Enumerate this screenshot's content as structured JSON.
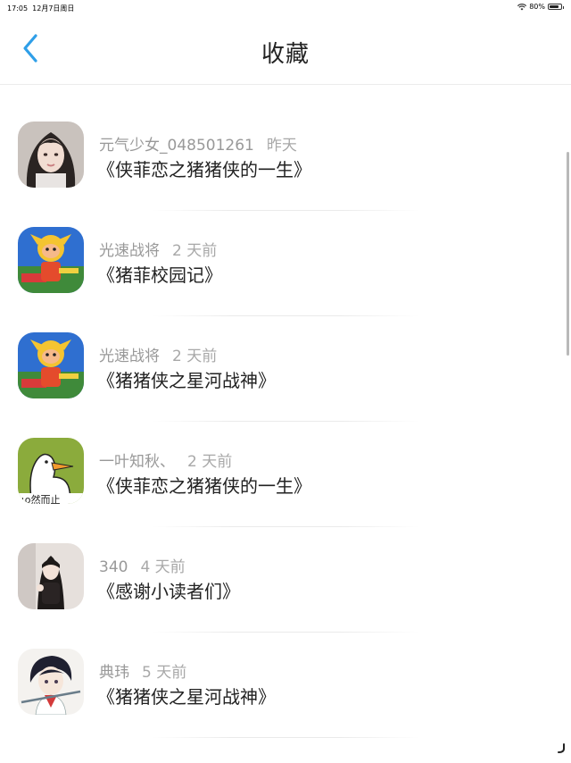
{
  "status_bar": {
    "time": "17:05",
    "date": "12月7日周日",
    "battery": "80%",
    "battery_level": 0.8
  },
  "nav": {
    "title": "收藏",
    "back_icon": "chevron-left-icon",
    "accent_color": "#2f9fe8"
  },
  "favorites": [
    {
      "user": "元气少女_048501261",
      "time": "昨天",
      "title": "《侠菲恋之猪猪侠的一生》",
      "avatar": "girl-portrait"
    },
    {
      "user": "光速战将",
      "time": "2 天前",
      "title": "《猪菲校园记》",
      "avatar": "cartoon-hero"
    },
    {
      "user": "光速战将",
      "time": "2 天前",
      "title": "《猪猪侠之星河战神》",
      "avatar": "cartoon-hero"
    },
    {
      "user": "一叶知秋、",
      "time": "2 天前",
      "title": "《侠菲恋之猪猪侠的一生》",
      "avatar": "duck-drawing"
    },
    {
      "user": "340",
      "time": "4 天前",
      "title": "《感谢小读者们》",
      "avatar": "girl-photo"
    },
    {
      "user": "典玮",
      "time": "5 天前",
      "title": "《猪猪侠之星河战神》",
      "avatar": "anime-boy"
    }
  ]
}
